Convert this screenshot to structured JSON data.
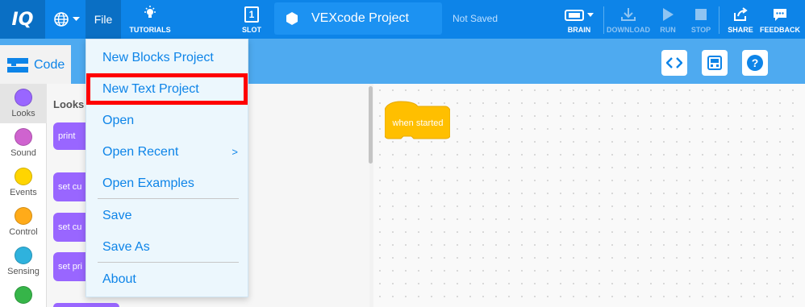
{
  "topbar": {
    "logo": "IQ",
    "file_label": "File",
    "tutorials_label": "TUTORIALS",
    "slot_label": "SLOT",
    "slot_number": "1",
    "project_name": "VEXcode Project",
    "save_status": "Not Saved",
    "brain_label": "BRAIN",
    "download_label": "DOWNLOAD",
    "run_label": "RUN",
    "stop_label": "STOP",
    "share_label": "SHARE",
    "feedback_label": "FEEDBACK"
  },
  "subbar": {
    "code_tab_label": "Code"
  },
  "categories": [
    {
      "label": "Looks",
      "color": "#9966ff"
    },
    {
      "label": "Sound",
      "color": "#cf63cf"
    },
    {
      "label": "Events",
      "color": "#ffd500"
    },
    {
      "label": "Control",
      "color": "#ffab19"
    },
    {
      "label": "Sensing",
      "color": "#2fb2dd"
    },
    {
      "label": "",
      "color": "#36b549"
    }
  ],
  "palette": {
    "title": "Looks",
    "blocks": [
      "print",
      "set cu",
      "set cu",
      "set pri"
    ]
  },
  "workspace": {
    "hat_block_label": "when started"
  },
  "file_menu": {
    "items": [
      {
        "label": "New Blocks Project"
      },
      {
        "label": "New Text Project"
      },
      {
        "label": "Open"
      },
      {
        "label": "Open Recent",
        "submenu_arrow": ">"
      },
      {
        "label": "Open Examples"
      },
      {
        "label": "Save"
      },
      {
        "label": "Save As"
      },
      {
        "label": "About"
      }
    ]
  },
  "colors": {
    "topbar": "#0d84e8",
    "subbar": "#4eaaf0",
    "highlight": "#ff0000",
    "looks_block": "#9966ff",
    "event_block": "#ffbf00"
  }
}
